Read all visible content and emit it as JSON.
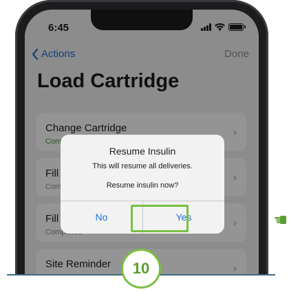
{
  "status_bar": {
    "time": "6:45"
  },
  "nav": {
    "back_label": "Actions",
    "done_label": "Done"
  },
  "page": {
    "title": "Load Cartridge"
  },
  "cards": [
    {
      "title": "Change Cartridge",
      "subtitle": "Completed"
    },
    {
      "title": "Fill Tubing",
      "subtitle": "Completed"
    },
    {
      "title": "Fill Cannula",
      "subtitle": "Completed"
    },
    {
      "title": "Site Reminder",
      "subtitle": ""
    }
  ],
  "alert": {
    "title": "Resume Insulin",
    "message": "This will resume all deliveries.",
    "question": "Resume insulin now?",
    "no_label": "No",
    "yes_label": "Yes"
  },
  "step": {
    "number": "10"
  },
  "colors": {
    "accent": "#1e6fd9",
    "highlight": "#78c043",
    "completed": "#3c9a3c",
    "baseline": "#3c6a80"
  }
}
